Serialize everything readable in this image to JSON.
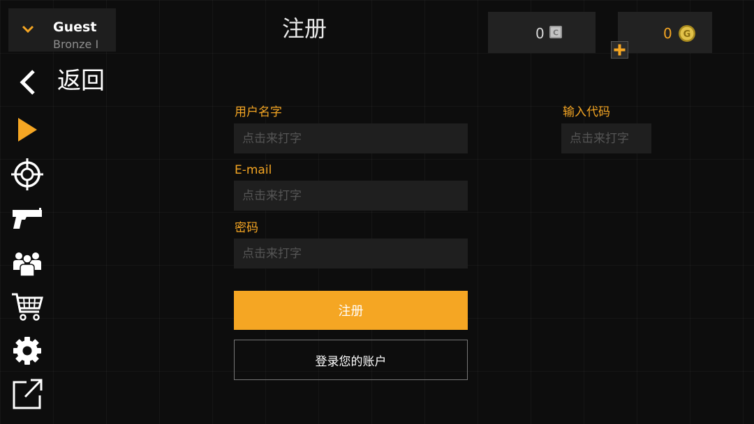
{
  "profile": {
    "name": "Guest",
    "rank": "Bronze I"
  },
  "header": {
    "title": "注册"
  },
  "currency": {
    "silver": "0",
    "gold": "0"
  },
  "nav": {
    "back_label": "返回",
    "icons": [
      "play-icon",
      "crosshair-icon",
      "pistol-icon",
      "group-icon",
      "cart-icon",
      "gear-icon",
      "external-link-icon"
    ]
  },
  "form": {
    "username_label": "用户名字",
    "username_placeholder": "点击来打字",
    "email_label": "E-mail",
    "email_placeholder": "点击来打字",
    "password_label": "密码",
    "password_placeholder": "点击来打字",
    "code_label": "输入代码",
    "code_placeholder": "点击来打字",
    "register_button": "注册",
    "login_button": "登录您的账户"
  },
  "colors": {
    "accent": "#f5a623",
    "background": "#0d0d0d",
    "field": "#1f1f1f"
  }
}
